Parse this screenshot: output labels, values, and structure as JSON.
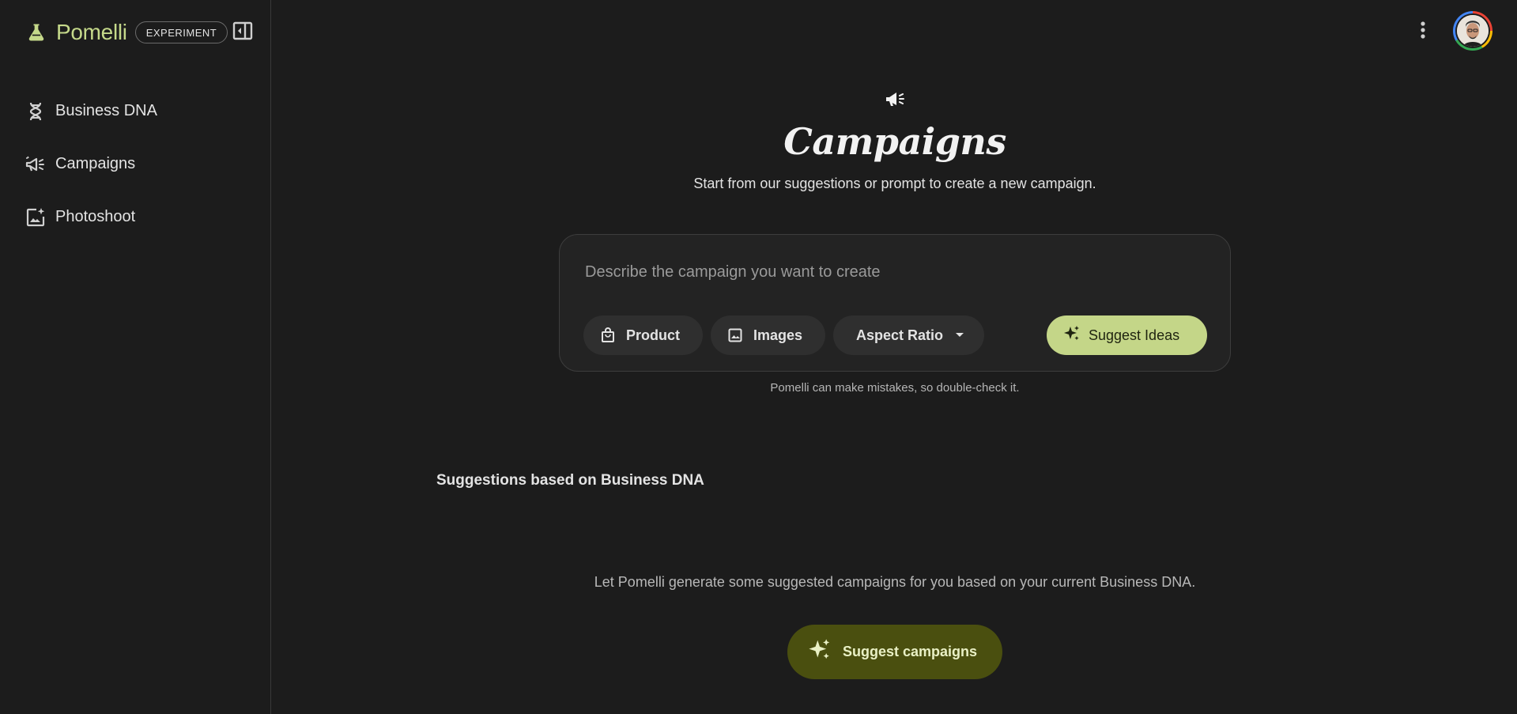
{
  "app": {
    "name": "Pomelli",
    "badge": "EXPERIMENT",
    "accent_color": "#c5d98a"
  },
  "sidebar": {
    "items": [
      {
        "label": "Business DNA",
        "icon": "dna-icon"
      },
      {
        "label": "Campaigns",
        "icon": "campaign-icon"
      },
      {
        "label": "Photoshoot",
        "icon": "photoshoot-icon"
      }
    ]
  },
  "header": {
    "menu_icon": "more-vert-icon",
    "avatar": "user-avatar"
  },
  "main": {
    "title": "Campaigns",
    "subtitle": "Start from our suggestions or prompt to create a new campaign.",
    "prompt": {
      "placeholder": "Describe the campaign you want to create",
      "value": "",
      "chips": {
        "product": "Product",
        "images": "Images",
        "aspect_ratio": "Aspect Ratio"
      },
      "suggest_button": "Suggest Ideas"
    },
    "disclaimer": "Pomelli can make mistakes, so double-check it.",
    "suggestions": {
      "title": "Suggestions based on Business DNA",
      "empty_text": "Let Pomelli generate some suggested campaigns for you based on your current Business DNA.",
      "button": "Suggest campaigns"
    }
  }
}
